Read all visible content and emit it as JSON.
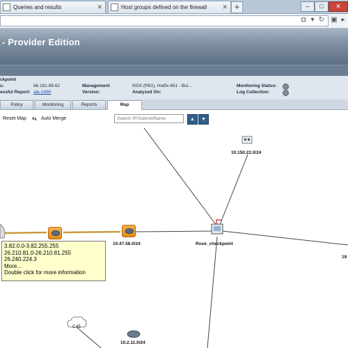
{
  "browser": {
    "tabs": [
      {
        "label": "Queries and results"
      },
      {
        "label": "Host groups defined on the firewall"
      }
    ],
    "new_tab": "+",
    "window_buttons": [
      "–",
      "□",
      "✕"
    ]
  },
  "app": {
    "banner_title": "- Provider Edition"
  },
  "info": {
    "name_label": "ckpoint",
    "ip_label": "s:",
    "ip_value": "66.181.88.62",
    "report_label": "essful Report:",
    "report_value": "ala-1490",
    "management_label": "Management",
    "management_value": "NGX (R61), Hotfix 661 - Bui...",
    "version_label": "Version:",
    "analyzed_label": "Analyzed On:",
    "monitoring_label": "Monitoring Status:",
    "log_label": "Log Collection:"
  },
  "tabs": [
    {
      "label": "Policy"
    },
    {
      "label": "Monitoring"
    },
    {
      "label": "Reports"
    },
    {
      "label": "Map"
    }
  ],
  "toolbar": {
    "reset_map": "Reset Map",
    "auto_merge": "Auto Merge",
    "search_placeholder": "Search IP/Subnet/Name"
  },
  "map": {
    "nodes": {
      "subnet_top": "10.150.22.0/24",
      "router_mid": "10.47.58.0/24",
      "firewall": "Rose_checkpoint",
      "right_edge": "19",
      "cloud": "C45",
      "bottom_router": "10.2.11.0/24"
    },
    "tooltip": [
      "3.82.0.0-3.82.255.255",
      "26.210.81.0-26.210.81.255",
      "26.240.224.3",
      "More...",
      "Double click for more information"
    ]
  }
}
